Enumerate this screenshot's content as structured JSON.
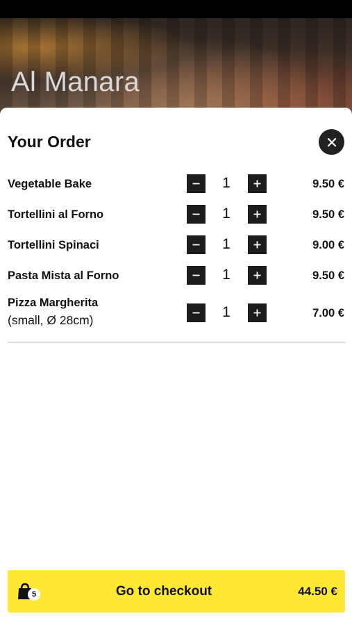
{
  "restaurant": {
    "name": "Al Manara"
  },
  "order": {
    "title": "Your Order",
    "items": [
      {
        "name": "Vegetable Bake",
        "sub": "",
        "quantity": "1",
        "price": "9.50 €"
      },
      {
        "name": "Tortellini al Forno",
        "sub": "",
        "quantity": "1",
        "price": "9.50 €"
      },
      {
        "name": "Tortellini Spinaci",
        "sub": "",
        "quantity": "1",
        "price": "9.00 €"
      },
      {
        "name": "Pasta Mista al Forno",
        "sub": "",
        "quantity": "1",
        "price": "9.50 €"
      },
      {
        "name": "Pizza Margherita",
        "sub": "(small, Ø 28cm)",
        "quantity": "1",
        "price": "7.00 €"
      }
    ]
  },
  "checkout": {
    "label": "Go to checkout",
    "total": "44.50 €",
    "bag_count": "5"
  },
  "icons": {
    "close": "close-icon",
    "minus": "minus-icon",
    "plus": "plus-icon",
    "bag": "shopping-bag-icon"
  },
  "colors": {
    "accent": "#ffe833",
    "dark": "#1c1c1c"
  }
}
